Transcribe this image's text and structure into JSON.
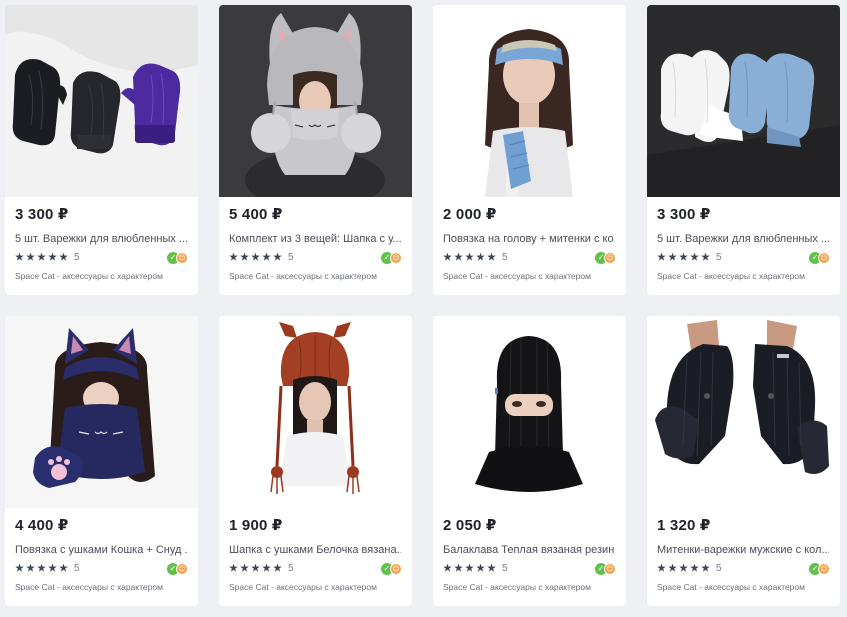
{
  "currency": "₽",
  "products": [
    {
      "price": "3 300 ₽",
      "title": "5 шт. Варежки для влюбленных ...",
      "rating": "5",
      "seller": "Space Cat - аксессуары с характером",
      "image": "black-and-purple-knitted-mittens",
      "verified_icon": "✓",
      "seller_icon": "☺"
    },
    {
      "price": "5 400 ₽",
      "title": "Комплект из 3 вещей: Шапка с у...",
      "rating": "5",
      "seller": "Space Cat - аксессуары с характером",
      "image": "grey-cat-ear-hat-and-snood",
      "verified_icon": "✓",
      "seller_icon": "☺"
    },
    {
      "price": "2 000 ₽",
      "title": "Повязка на голову + митенки с ко...",
      "rating": "5",
      "seller": "Space Cat - аксессуары с характером",
      "image": "blue-headband-and-fingerless-gloves",
      "verified_icon": "✓",
      "seller_icon": "☺"
    },
    {
      "price": "3 300 ₽",
      "title": "5 шт. Варежки для влюбленных ...",
      "rating": "5",
      "seller": "Space Cat - аксессуары с характером",
      "image": "white-and-light-blue-mittens",
      "verified_icon": "✓",
      "seller_icon": "☺"
    },
    {
      "price": "4 400 ₽",
      "title": "Повязка с ушками Кошка + Снуд ...",
      "rating": "5",
      "seller": "Space Cat - аксессуары с характером",
      "image": "navy-cat-ear-headband-and-snood",
      "verified_icon": "✓",
      "seller_icon": "☺"
    },
    {
      "price": "1 900 ₽",
      "title": "Шапка с ушками Белочка вязана...",
      "rating": "5",
      "seller": "Space Cat - аксессуары с характером",
      "image": "rust-squirrel-ear-hat",
      "verified_icon": "✓",
      "seller_icon": "☺"
    },
    {
      "price": "2 050 ₽",
      "title": "Балаклава Теплая вязаная резин...",
      "rating": "5",
      "seller": "Space Cat - аксессуары с характером",
      "image": "black-knitted-balaclava",
      "verified_icon": "✓",
      "seller_icon": "☺"
    },
    {
      "price": "1 320 ₽",
      "title": "Митенки-варежки мужские с кол...",
      "rating": "5",
      "seller": "Space Cat - аксессуары с характером",
      "image": "black-convertible-mittens",
      "verified_icon": "✓",
      "seller_icon": "☺"
    }
  ]
}
